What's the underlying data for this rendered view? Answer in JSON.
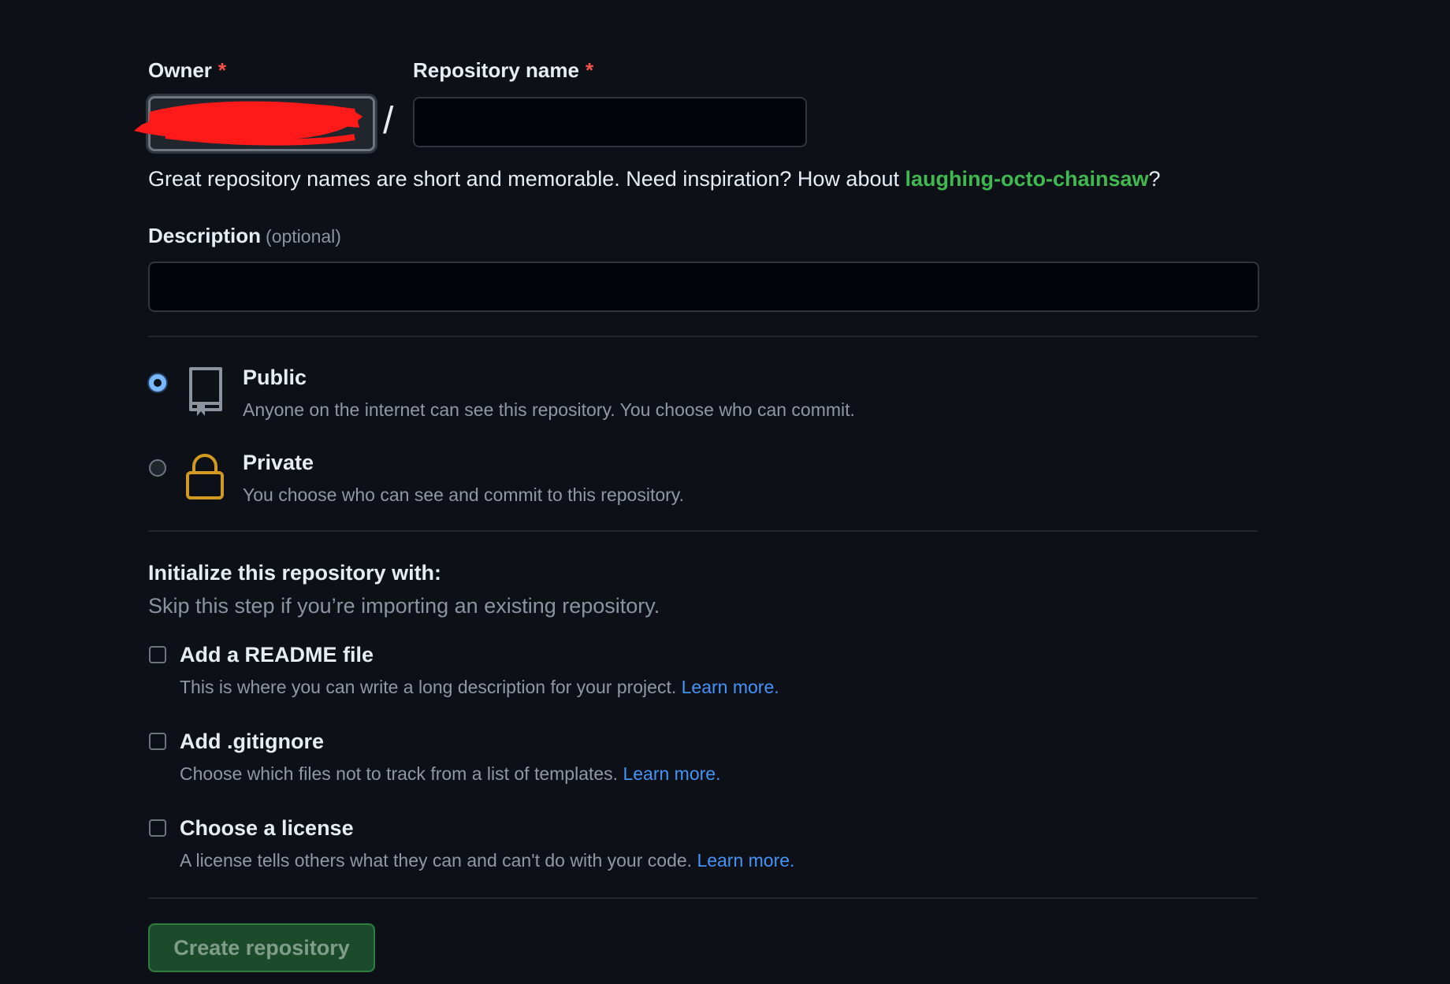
{
  "owner": {
    "label": "Owner",
    "required_mark": "*"
  },
  "repo_name": {
    "label": "Repository name",
    "required_mark": "*",
    "value": ""
  },
  "separator": "/",
  "hint": {
    "text": "Great repository names are short and memorable. Need inspiration? How about ",
    "suggestion": "laughing-octo-chainsaw",
    "end": "?"
  },
  "description": {
    "label": "Description",
    "optional": "(optional)",
    "value": ""
  },
  "visibility": {
    "public": {
      "title": "Public",
      "desc": "Anyone on the internet can see this repository. You choose who can commit.",
      "selected": true
    },
    "private": {
      "title": "Private",
      "desc": "You choose who can see and commit to this repository.",
      "selected": false
    }
  },
  "init": {
    "title": "Initialize this repository with:",
    "subtitle": "Skip this step if you’re importing an existing repository.",
    "options": [
      {
        "title": "Add a README file",
        "desc": "This is where you can write a long description for your project. ",
        "link": "Learn more.",
        "checked": false
      },
      {
        "title": "Add .gitignore",
        "desc": "Choose which files not to track from a list of templates. ",
        "link": "Learn more.",
        "checked": false
      },
      {
        "title": "Choose a license",
        "desc": "A license tells others what they can and can't do with your code. ",
        "link": "Learn more.",
        "checked": false
      }
    ]
  },
  "create_button": "Create repository",
  "colors": {
    "accent_link": "#4493f8",
    "suggestion": "#3fb950",
    "required": "#f85149",
    "lock_icon": "#d29922",
    "redaction": "#ff1a1a"
  }
}
